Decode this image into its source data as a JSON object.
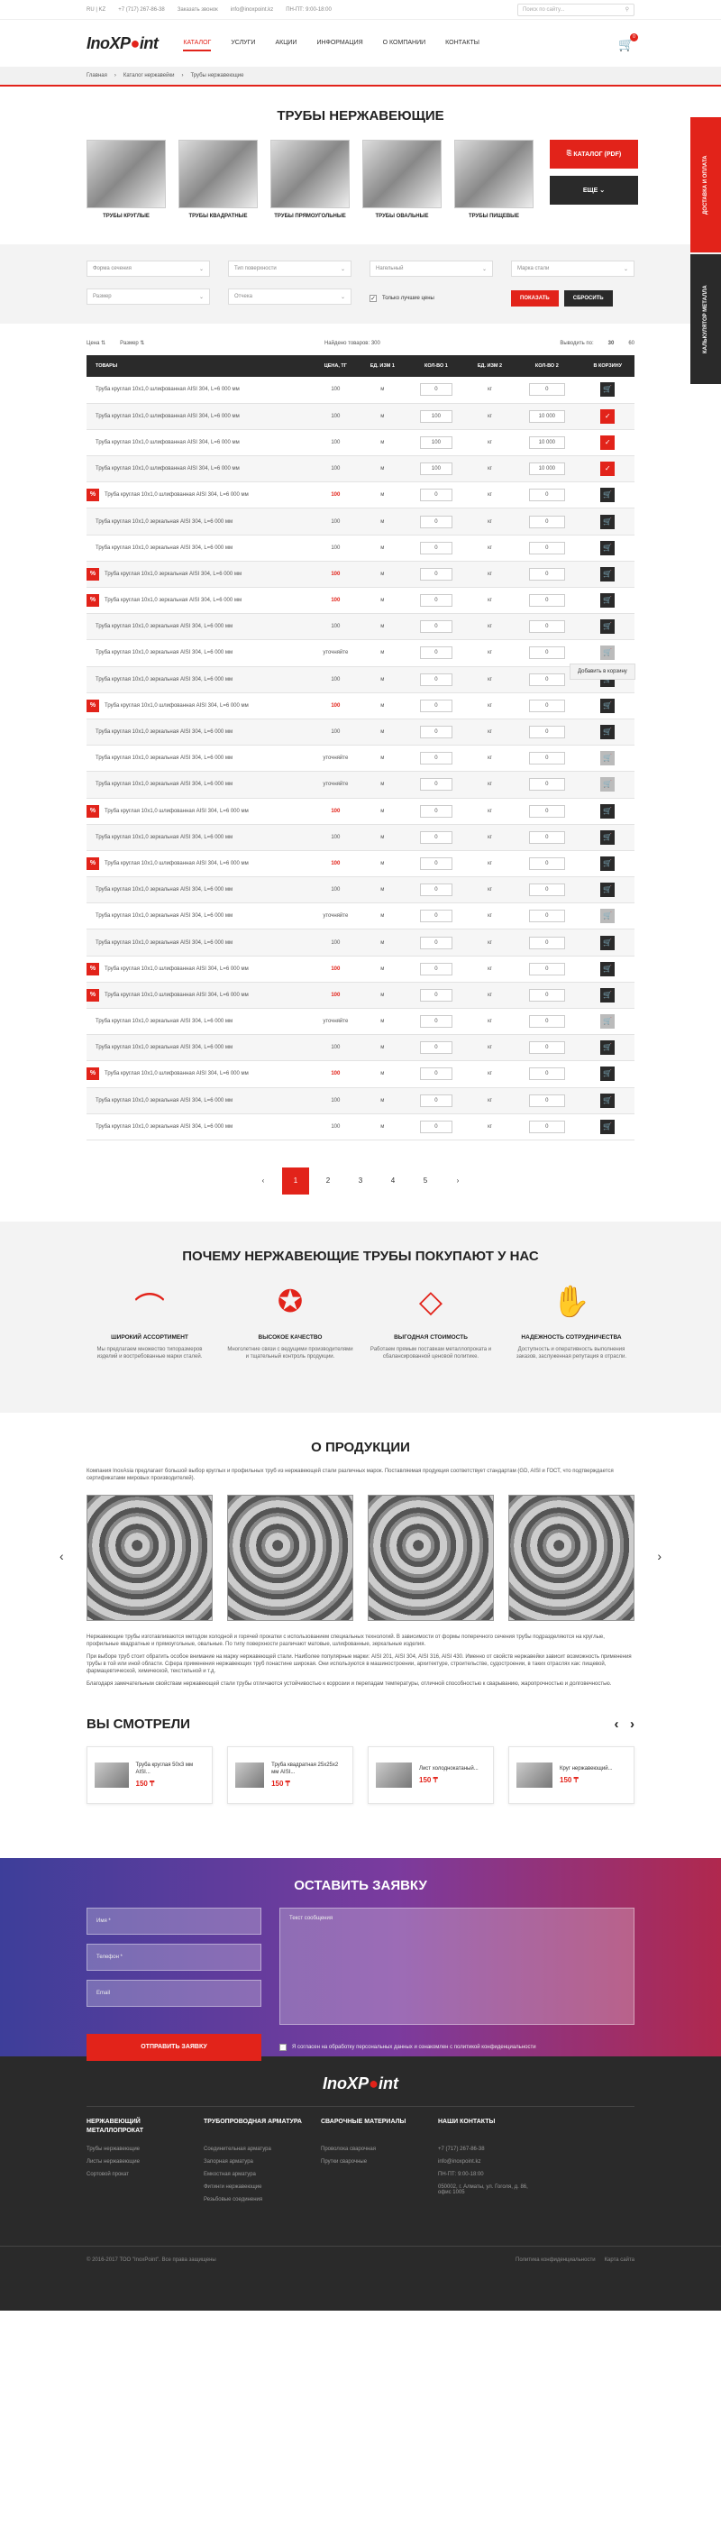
{
  "topbar": {
    "lang": "RU | KZ",
    "phone": "+7 (717) 267-86-38",
    "callback": "Заказать звонок",
    "email": "info@inoxpoint.kz",
    "hours": "ПН-ПТ: 9:00-18:00",
    "search_placeholder": "Поиск по сайту..."
  },
  "header": {
    "logo_a": "Ino",
    "logo_x": "X",
    "logo_b": "P",
    "logo_c": "int",
    "nav": [
      "КАТАЛОГ",
      "УСЛУГИ",
      "АКЦИИ",
      "ИНФОРМАЦИЯ",
      "О КОМПАНИИ",
      "КОНТАКТЫ"
    ],
    "cart_count": "0"
  },
  "breadcrumb": [
    "Главная",
    "Каталог нержавейки",
    "Трубы нержавеющие"
  ],
  "page_title": "ТРУБЫ НЕРЖАВЕЮЩИЕ",
  "categories": [
    "ТРУБЫ КРУГЛЫЕ",
    "ТРУБЫ КВАДРАТНЫЕ",
    "ТРУБЫ ПРЯМОУГОЛЬНЫЕ",
    "ТРУБЫ ОВАЛЬНЫЕ",
    "ТРУБЫ ПИЩЕВЫЕ"
  ],
  "catalog_btn": "КАТАЛОГ (PDF)",
  "more_btn": "ЕЩЕ",
  "filters": {
    "f1": "Форма сечения",
    "f2": "Тип поверхности",
    "f3": "Нагельный",
    "f4": "Марка стали",
    "f5": "Размер",
    "f6": "Отчека",
    "only_best": "Только лучшие цены",
    "show": "ПОКАЗАТЬ",
    "reset": "СБРОСИТЬ"
  },
  "sort": {
    "price": "Цена",
    "size": "Размер",
    "found": "Найдено товаров: 300",
    "per_page": "Выводить по:",
    "p1": "30",
    "p2": "60"
  },
  "table": {
    "headers": [
      "ТОВАРЫ",
      "ЦЕНА, ТГ",
      "ЕД. ИЗМ 1",
      "КОЛ-ВО 1",
      "ЕД. ИЗМ 2",
      "КОЛ-ВО 2",
      "В КОРЗИНУ"
    ],
    "rows": [
      {
        "n": "Труба круглая 10х1,0 шлифованная AISI 304, L=6 000 мм",
        "p": "100",
        "pr": false,
        "d": false,
        "u1": "м",
        "q1": "0",
        "u2": "кг",
        "q2": "0",
        "c": "cart"
      },
      {
        "n": "Труба круглая 10х1,0 шлифованная AISI 304, L=6 000 мм",
        "p": "100",
        "pr": false,
        "d": false,
        "u1": "м",
        "q1": "100",
        "u2": "кг",
        "q2": "10 000",
        "c": "on"
      },
      {
        "n": "Труба круглая 10х1,0 шлифованная AISI 304, L=6 000 мм",
        "p": "100",
        "pr": false,
        "d": false,
        "u1": "м",
        "q1": "100",
        "u2": "кг",
        "q2": "10 000",
        "c": "on"
      },
      {
        "n": "Труба круглая 10х1,0 шлифованная AISI 304, L=6 000 мм",
        "p": "100",
        "pr": false,
        "d": false,
        "u1": "м",
        "q1": "100",
        "u2": "кг",
        "q2": "10 000",
        "c": "on"
      },
      {
        "n": "Труба круглая 10х1,0 шлифованная AISI 304, L=6 000 мм",
        "p": "100",
        "pr": true,
        "d": true,
        "u1": "м",
        "q1": "0",
        "u2": "кг",
        "q2": "0",
        "c": "cart"
      },
      {
        "n": "Труба круглая 10х1,0 зеркальная AISI 304, L=6 000 мм",
        "p": "100",
        "pr": false,
        "d": false,
        "u1": "м",
        "q1": "0",
        "u2": "кг",
        "q2": "0",
        "c": "cart"
      },
      {
        "n": "Труба круглая 10х1,0 зеркальная AISI 304, L=6 000 мм",
        "p": "100",
        "pr": false,
        "d": false,
        "u1": "м",
        "q1": "0",
        "u2": "кг",
        "q2": "0",
        "c": "cart"
      },
      {
        "n": "Труба круглая 10х1,0 зеркальная AISI 304, L=6 000 мм",
        "p": "100",
        "pr": true,
        "d": true,
        "u1": "м",
        "q1": "0",
        "u2": "кг",
        "q2": "0",
        "c": "cart"
      },
      {
        "n": "Труба круглая 10х1,0 зеркальная AISI 304, L=6 000 мм",
        "p": "100",
        "pr": true,
        "d": true,
        "u1": "м",
        "q1": "0",
        "u2": "кг",
        "q2": "0",
        "c": "cart"
      },
      {
        "n": "Труба круглая 10х1,0 зеркальная AISI 304, L=6 000 мм",
        "p": "100",
        "pr": false,
        "d": false,
        "u1": "м",
        "q1": "0",
        "u2": "кг",
        "q2": "0",
        "c": "cart"
      },
      {
        "n": "Труба круглая 10х1,0 зеркальная AISI 304, L=6 000 мм",
        "p": "уточняйте",
        "pr": false,
        "d": false,
        "u1": "м",
        "q1": "0",
        "u2": "кг",
        "q2": "0",
        "c": "off"
      },
      {
        "n": "Труба круглая 10х1,0 зеркальная AISI 304, L=6 000 мм",
        "p": "100",
        "pr": false,
        "d": false,
        "u1": "м",
        "q1": "0",
        "u2": "кг",
        "q2": "0",
        "c": "cart"
      },
      {
        "n": "Труба круглая 10х1,0 шлифованная AISI 304, L=6 000 мм",
        "p": "100",
        "pr": true,
        "d": true,
        "u1": "м",
        "q1": "0",
        "u2": "кг",
        "q2": "0",
        "c": "cart"
      },
      {
        "n": "Труба круглая 10х1,0 зеркальная AISI 304, L=6 000 мм",
        "p": "100",
        "pr": false,
        "d": false,
        "u1": "м",
        "q1": "0",
        "u2": "кг",
        "q2": "0",
        "c": "cart"
      },
      {
        "n": "Труба круглая 10х1,0 зеркальная AISI 304, L=6 000 мм",
        "p": "уточняйте",
        "pr": false,
        "d": false,
        "u1": "м",
        "q1": "0",
        "u2": "кг",
        "q2": "0",
        "c": "off"
      },
      {
        "n": "Труба круглая 10х1,0 зеркальная AISI 304, L=6 000 мм",
        "p": "уточняйте",
        "pr": false,
        "d": false,
        "u1": "м",
        "q1": "0",
        "u2": "кг",
        "q2": "0",
        "c": "off"
      },
      {
        "n": "Труба круглая 10х1,0 шлифованная AISI 304, L=6 000 мм",
        "p": "100",
        "pr": true,
        "d": true,
        "u1": "м",
        "q1": "0",
        "u2": "кг",
        "q2": "0",
        "c": "cart"
      },
      {
        "n": "Труба круглая 10х1,0 зеркальная AISI 304, L=6 000 мм",
        "p": "100",
        "pr": false,
        "d": false,
        "u1": "м",
        "q1": "0",
        "u2": "кг",
        "q2": "0",
        "c": "cart"
      },
      {
        "n": "Труба круглая 10х1,0 шлифованная AISI 304, L=6 000 мм",
        "p": "100",
        "pr": true,
        "d": true,
        "u1": "м",
        "q1": "0",
        "u2": "кг",
        "q2": "0",
        "c": "cart"
      },
      {
        "n": "Труба круглая 10х1,0 зеркальная AISI 304, L=6 000 мм",
        "p": "100",
        "pr": false,
        "d": false,
        "u1": "м",
        "q1": "0",
        "u2": "кг",
        "q2": "0",
        "c": "cart"
      },
      {
        "n": "Труба круглая 10х1,0 зеркальная AISI 304, L=6 000 мм",
        "p": "уточняйте",
        "pr": false,
        "d": false,
        "u1": "м",
        "q1": "0",
        "u2": "кг",
        "q2": "0",
        "c": "off"
      },
      {
        "n": "Труба круглая 10х1,0 зеркальная AISI 304, L=6 000 мм",
        "p": "100",
        "pr": false,
        "d": false,
        "u1": "м",
        "q1": "0",
        "u2": "кг",
        "q2": "0",
        "c": "cart"
      },
      {
        "n": "Труба круглая 10х1,0 шлифованная AISI 304, L=6 000 мм",
        "p": "100",
        "pr": true,
        "d": true,
        "u1": "м",
        "q1": "0",
        "u2": "кг",
        "q2": "0",
        "c": "cart"
      },
      {
        "n": "Труба круглая 10х1,0 шлифованная AISI 304, L=6 000 мм",
        "p": "100",
        "pr": true,
        "d": true,
        "u1": "м",
        "q1": "0",
        "u2": "кг",
        "q2": "0",
        "c": "cart"
      },
      {
        "n": "Труба круглая 10х1,0 зеркальная AISI 304, L=6 000 мм",
        "p": "уточняйте",
        "pr": false,
        "d": false,
        "u1": "м",
        "q1": "0",
        "u2": "кг",
        "q2": "0",
        "c": "off"
      },
      {
        "n": "Труба круглая 10х1,0 зеркальная AISI 304, L=6 000 мм",
        "p": "100",
        "pr": false,
        "d": false,
        "u1": "м",
        "q1": "0",
        "u2": "кг",
        "q2": "0",
        "c": "cart"
      },
      {
        "n": "Труба круглая 10х1,0 шлифованная AISI 304, L=6 000 мм",
        "p": "100",
        "pr": true,
        "d": true,
        "u1": "м",
        "q1": "0",
        "u2": "кг",
        "q2": "0",
        "c": "cart"
      },
      {
        "n": "Труба круглая 10х1,0 зеркальная AISI 304, L=6 000 мм",
        "p": "100",
        "pr": false,
        "d": false,
        "u1": "м",
        "q1": "0",
        "u2": "кг",
        "q2": "0",
        "c": "cart"
      },
      {
        "n": "Труба круглая 10х1,0 зеркальная AISI 304, L=6 000 мм",
        "p": "100",
        "pr": false,
        "d": false,
        "u1": "м",
        "q1": "0",
        "u2": "кг",
        "q2": "0",
        "c": "cart"
      }
    ]
  },
  "tooltip": "Добавить в корзину",
  "pager": [
    "1",
    "2",
    "3",
    "4",
    "5"
  ],
  "why": {
    "title": "ПОЧЕМУ НЕРЖАВЕЮЩИЕ ТРУБЫ ПОКУПАЮТ У НАС",
    "items": [
      {
        "t": "ШИРОКИЙ АССОРТИМЕНТ",
        "d": "Мы предлагаем множество типоразмеров изделий и востребованные марки сталей."
      },
      {
        "t": "ВЫСОКОЕ КАЧЕСТВО",
        "d": "Многолетние связи с ведущими производителями и тщательный контроль продукции."
      },
      {
        "t": "ВЫГОДНАЯ СТОИМОСТЬ",
        "d": "Работаем прямым поставкам металлопроката и сбалансированной ценовой политике."
      },
      {
        "t": "НАДЕЖНОСТЬ СОТРУДНИЧЕСТВА",
        "d": "Доступность и оперативность выполнения заказов, заслуженная репутация в отрасли."
      }
    ]
  },
  "about": {
    "title": "О ПРОДУКЦИИ",
    "p1": "Компания InoxAsia предлагает большой выбор круглых и профильных труб из нержавеющей стали различных марок. Поставляемая продукция соответствует стандартам (GD, AISI и ГОСТ, что подтверждается сертификатами мировых производителей).",
    "p2": "Нержавеющие трубы изготавливаются методом холодной и горячей прокатки с использованием специальных технологий. В зависимости от формы поперечного сечения трубы подразделяются на круглые, профильные квадратные и прямоугольные, овальные. По типу поверхности различают матовые, шлифованные, зеркальные изделия.",
    "p3": "При выборе труб стоит обратить особое внимание на марку нержавеющей стали. Наиболее популярные марки: AISI 201, AISI 304, AISI 316, AISI 430. Именно от свойств нержавейки зависит возможность применения трубы в той или иной области. Сфера применения нержавеющих труб понастине широкая. Они используются в машиностроении, архитектуре, строительстве, судостроении, в таких отраслях как: пищевой, фармацевтической, химической, текстильной и т.д.",
    "p4": "Благодаря замечательным свойствам нержавеющей стали трубы отличаются устойчивостью к коррозии и перепадам температуры, отличной способностью к сварыванию, жаропрочностью и долговечностью."
  },
  "seen": {
    "title": "ВЫ СМОТРЕЛИ",
    "items": [
      {
        "n": "Труба круглая 50х3 мм AISI...",
        "p": "150 ₸"
      },
      {
        "n": "Труба квадратная 25х25х2 мм AISI...",
        "p": "150 ₸"
      },
      {
        "n": "Лист холоднокатаный...",
        "p": "150 ₸"
      },
      {
        "n": "Круг нержавеющий...",
        "p": "150 ₸"
      }
    ]
  },
  "form": {
    "title": "ОСТАВИТЬ ЗАЯВКУ",
    "name": "Имя *",
    "phone": "Телефон *",
    "email": "Email",
    "message": "Текст сообщения",
    "send": "ОТПРАВИТЬ ЗАЯВКУ",
    "agree": "Я согласен на обработку персональных данных и ознакомлен с политикой конфиденциальности"
  },
  "footer": {
    "cols": [
      {
        "t": "НЕРЖАВЕЮЩИЙ МЕТАЛЛОПРОКАТ",
        "i": [
          "Трубы нержавеющие",
          "Листы нержавеющие",
          "Сортовой прокат"
        ]
      },
      {
        "t": "ТРУБОПРОВОДНАЯ АРМАТУРА",
        "i": [
          "Соединительная арматура",
          "Запорная арматура",
          "Емкостная арматура",
          "Фитинги нержавеющие",
          "Резьбовые соединения"
        ]
      },
      {
        "t": "СВАРОЧНЫЕ МАТЕРИАЛЫ",
        "i": [
          "Проволока сварочная",
          "Прутки сварочные"
        ]
      },
      {
        "t": "НАШИ КОНТАКТЫ",
        "i": [
          "+7 (717) 267-86-38",
          "info@inoxpoint.kz",
          "ПН-ПТ: 9:00-18:00",
          "050002, г. Алматы, ул. Гоголя, д. 86, офис 1005"
        ]
      }
    ],
    "copy": "© 2016-2017 ТОО \"InoxPoint\". Все права защищены",
    "privacy": "Политика конфиденциальности",
    "sitemap": "Карта сайта"
  },
  "side": {
    "delivery": "ДОСТАВКА И ОПЛАТА",
    "calc": "КАЛЬКУЛЯТОР МЕТАЛЛА"
  }
}
